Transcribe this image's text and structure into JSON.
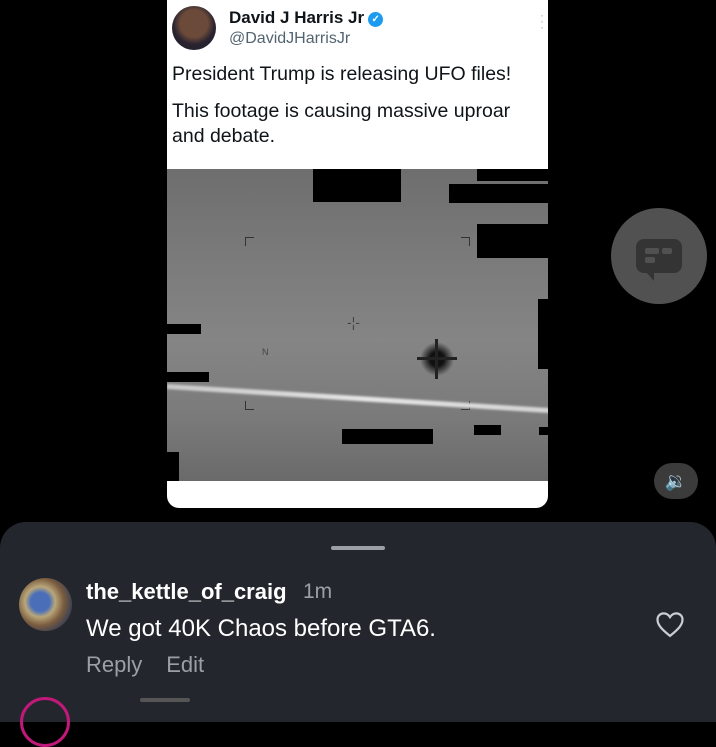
{
  "tweet": {
    "name": "David J Harris Jr",
    "handle": "@DavidJHarrisJr",
    "line1": "President Trump is releasing UFO files!",
    "line2": "This footage is causing massive uproar and debate.",
    "verified_icon": "verified-badge-icon",
    "video_marker": "N"
  },
  "overlay": {
    "chat_icon": "comment-bubble-icon",
    "volume_icon": "speaker-icon",
    "volume_glyph": "🔉"
  },
  "comment": {
    "username": "the_kettle_of_craig",
    "time": "1m",
    "text": "We got 40K Chaos before GTA6.",
    "reply_label": "Reply",
    "edit_label": "Edit",
    "like_icon": "heart-icon"
  },
  "colors": {
    "sheet_bg": "#23272d",
    "verified": "#1d9bf0",
    "muted_text": "#9aa0a6"
  }
}
